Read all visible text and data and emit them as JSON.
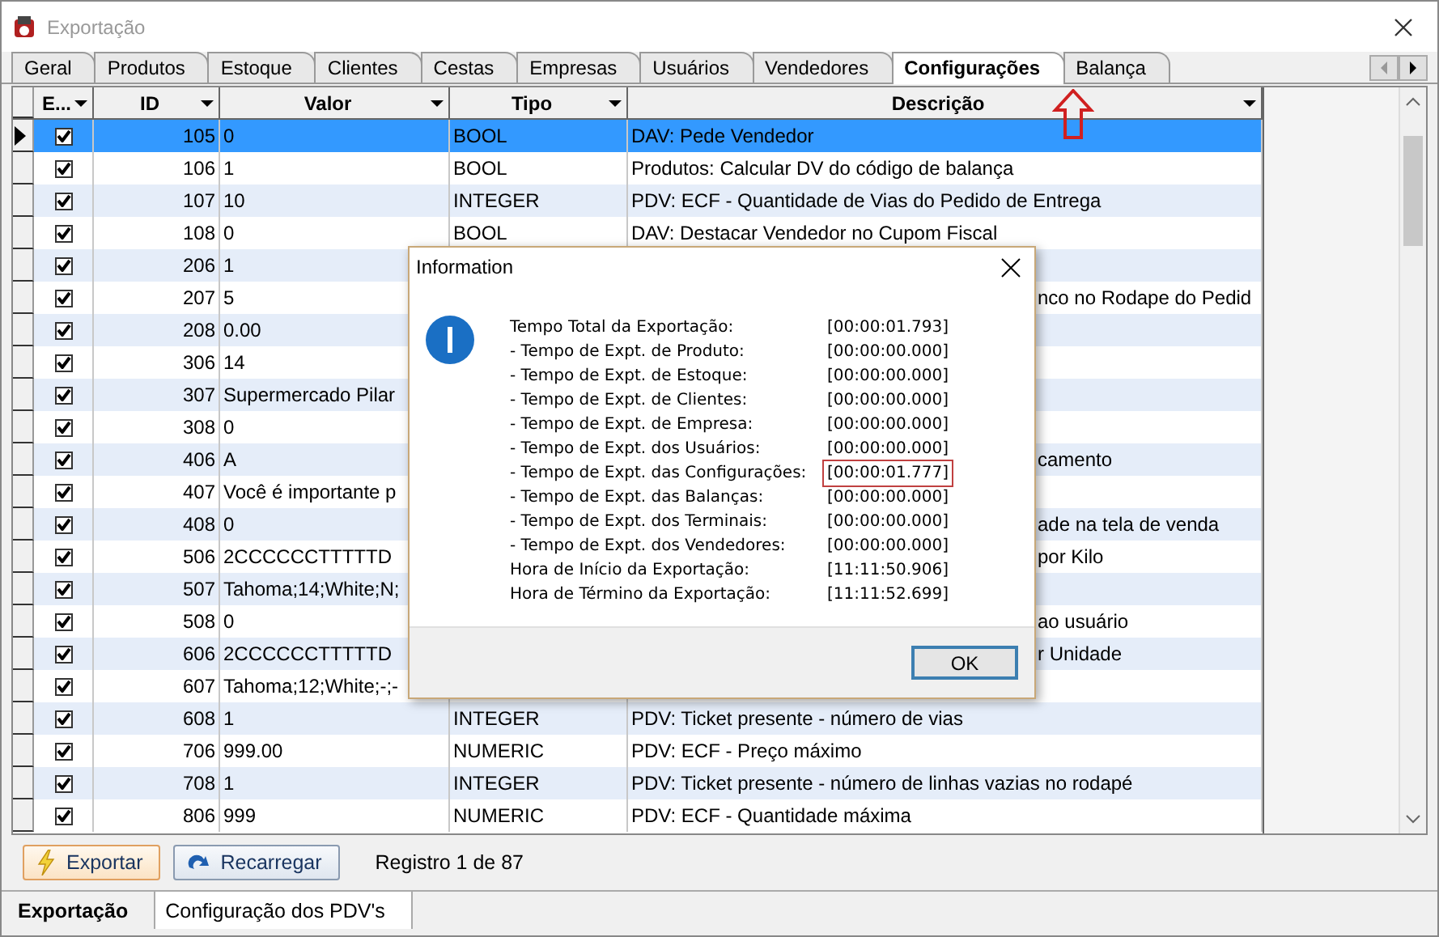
{
  "window": {
    "title": "Exportação"
  },
  "tabs": [
    {
      "label": "Geral",
      "selected": false
    },
    {
      "label": "Produtos",
      "selected": false
    },
    {
      "label": "Estoque",
      "selected": false
    },
    {
      "label": "Clientes",
      "selected": false
    },
    {
      "label": "Cestas",
      "selected": false
    },
    {
      "label": "Empresas",
      "selected": false
    },
    {
      "label": "Usuários",
      "selected": false
    },
    {
      "label": "Vendedores",
      "selected": false
    },
    {
      "label": "Configurações",
      "selected": true
    },
    {
      "label": "Balança",
      "selected": false
    }
  ],
  "grid": {
    "columns": [
      {
        "label": "E..."
      },
      {
        "label": "ID"
      },
      {
        "label": "Valor"
      },
      {
        "label": "Tipo"
      },
      {
        "label": "Descrição"
      }
    ],
    "rows": [
      {
        "id": "105",
        "valor": "0",
        "tipo": "BOOL",
        "descricao": "DAV: Pede Vendedor",
        "checked": true,
        "selected": true
      },
      {
        "id": "106",
        "valor": "1",
        "tipo": "BOOL",
        "descricao": "Produtos: Calcular DV do código de balança",
        "checked": true,
        "selected": false
      },
      {
        "id": "107",
        "valor": "10",
        "tipo": "INTEGER",
        "descricao": "PDV: ECF - Quantidade de Vias do Pedido de Entrega",
        "checked": true,
        "selected": false
      },
      {
        "id": "108",
        "valor": "0",
        "tipo": "BOOL",
        "descricao": "DAV: Destacar Vendedor no Cupom Fiscal",
        "checked": true,
        "selected": false
      },
      {
        "id": "206",
        "valor": "1",
        "checked": true,
        "selected": false
      },
      {
        "id": "207",
        "valor": "5",
        "descricao": "nco no Rodape do Pedid",
        "tail": true,
        "checked": true,
        "selected": false
      },
      {
        "id": "208",
        "valor": "0.00",
        "checked": true,
        "selected": false
      },
      {
        "id": "306",
        "valor": "14",
        "checked": true,
        "selected": false
      },
      {
        "id": "307",
        "valor": "Supermercado Pilar",
        "checked": true,
        "selected": false
      },
      {
        "id": "308",
        "valor": "0",
        "checked": true,
        "selected": false
      },
      {
        "id": "406",
        "valor": "A",
        "descricao": "camento",
        "tail": true,
        "checked": true,
        "selected": false
      },
      {
        "id": "407",
        "valor": "Você é importante p",
        "checked": true,
        "selected": false
      },
      {
        "id": "408",
        "valor": "0",
        "descricao": "ade na tela de venda",
        "tail": true,
        "checked": true,
        "selected": false
      },
      {
        "id": "506",
        "valor": "2CCCCCCTTTTTD",
        "descricao": "por Kilo",
        "tail": true,
        "checked": true,
        "selected": false
      },
      {
        "id": "507",
        "valor": "Tahoma;14;White;N;",
        "checked": true,
        "selected": false
      },
      {
        "id": "508",
        "valor": "0",
        "descricao": "ao usuário",
        "tail": true,
        "checked": true,
        "selected": false
      },
      {
        "id": "606",
        "valor": "2CCCCCCTTTTTD",
        "descricao": "r Unidade",
        "tail": true,
        "checked": true,
        "selected": false
      },
      {
        "id": "607",
        "valor": "Tahoma;12;White;-;-",
        "checked": true,
        "selected": false
      },
      {
        "id": "608",
        "valor": "1",
        "tipo": "INTEGER",
        "descricao": "PDV: Ticket presente - número de vias",
        "checked": true,
        "selected": false
      },
      {
        "id": "706",
        "valor": "999.00",
        "tipo": "NUMERIC",
        "descricao": "PDV: ECF - Preço máximo",
        "checked": true,
        "selected": false
      },
      {
        "id": "708",
        "valor": "1",
        "tipo": "INTEGER",
        "descricao": "PDV: Ticket presente - número de linhas vazias no rodapé",
        "checked": true,
        "selected": false
      },
      {
        "id": "806",
        "valor": "999",
        "tipo": "NUMERIC",
        "descricao": "PDV: ECF - Quantidade máxima",
        "checked": true,
        "selected": false
      }
    ]
  },
  "toolbar": {
    "buttons": [
      {
        "label": "Exportar",
        "kind": "export",
        "focused": true
      },
      {
        "label": "Recarregar",
        "kind": "reload",
        "focused": false
      }
    ],
    "record_text": "Registro 1 de 87"
  },
  "bottom_tabs": [
    {
      "label": "Exportação",
      "selected": true
    },
    {
      "label": "Configuração dos PDV's",
      "selected": false
    }
  ],
  "dialog": {
    "title": "Information",
    "lines": [
      {
        "label": "Tempo Total da Exportação:",
        "value": "[00:00:01.793]",
        "highlighted": false
      },
      {
        "label": "- Tempo de Expt. de Produto:",
        "value": "[00:00:00.000]",
        "highlighted": false
      },
      {
        "label": "- Tempo de Expt. de Estoque:",
        "value": "[00:00:00.000]",
        "highlighted": false
      },
      {
        "label": "- Tempo de Expt. de Clientes:",
        "value": "[00:00:00.000]",
        "highlighted": false
      },
      {
        "label": "- Tempo de Expt. de Empresa:",
        "value": "[00:00:00.000]",
        "highlighted": false
      },
      {
        "label": "- Tempo de Expt. dos Usuários:",
        "value": "[00:00:00.000]",
        "highlighted": false
      },
      {
        "label": "- Tempo de Expt. das Configurações:",
        "value": "[00:00:01.777]",
        "highlighted": true
      },
      {
        "label": "- Tempo de Expt. das Balanças:",
        "value": "[00:00:00.000]",
        "highlighted": false
      },
      {
        "label": "- Tempo de Expt. dos Terminais:",
        "value": "[00:00:00.000]",
        "highlighted": false
      },
      {
        "label": "- Tempo de Expt. dos Vendedores:",
        "value": "[00:00:00.000]",
        "highlighted": false
      },
      {
        "label": "Hora de Início da Exportação:",
        "value": "[11:11:50.906]",
        "highlighted": false
      },
      {
        "label": "Hora de Término da Exportação:",
        "value": "[11:11:52.699]",
        "highlighted": false
      }
    ],
    "button": "OK"
  }
}
